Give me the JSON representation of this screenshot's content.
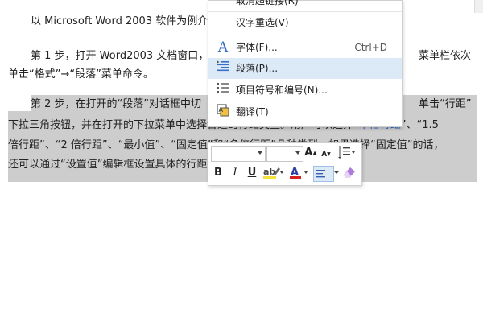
{
  "document": {
    "lines": [
      "以 Microsoft Word 2003 软件为例介",
      "第 1 步，打开 Word2003 文档窗口，",
      "单击“格式”→“段落”菜单命令。",
      "第 2 步，在打开的“段落”对话框中切",
      "下拉三角按钮，并在打开的下拉菜单中选择合适的行距类型。用户可以选择“单倍行距”、“1.5",
      "倍行距”、“2 倍行距”、“最小值”、“固定值”和“多倍行距”几种类型。如果选择“固定值”的话，",
      "还可以通过“设置值”编辑框设置具体的行距值，最后单击“确定”即可。"
    ],
    "right_fragments": [
      "菜单栏依次",
      "单击“行距”"
    ]
  },
  "context_menu": {
    "items": [
      {
        "label": "取消超链接(R)",
        "shortcut": "",
        "icon": "none"
      },
      {
        "label": "汉字重选(V)",
        "shortcut": "",
        "icon": "none"
      },
      {
        "label": "字体(F)...",
        "shortcut": "Ctrl+D",
        "icon": "font-A-icon"
      },
      {
        "label": "段落(P)...",
        "shortcut": "",
        "icon": "paragraph-icon"
      },
      {
        "label": "项目符号和编号(N)...",
        "shortcut": "",
        "icon": "bullets-icon"
      },
      {
        "label": "翻译(T)",
        "shortcut": "",
        "icon": "translate-icon"
      }
    ],
    "highlighted_index": 3
  },
  "mini_toolbar": {
    "grow_font": "A",
    "shrink_font": "A",
    "bold": "B",
    "italic": "I",
    "underline": "U",
    "font_color_letter": "A",
    "highlight_color": "#f5e23a",
    "font_color": "#d42020"
  }
}
